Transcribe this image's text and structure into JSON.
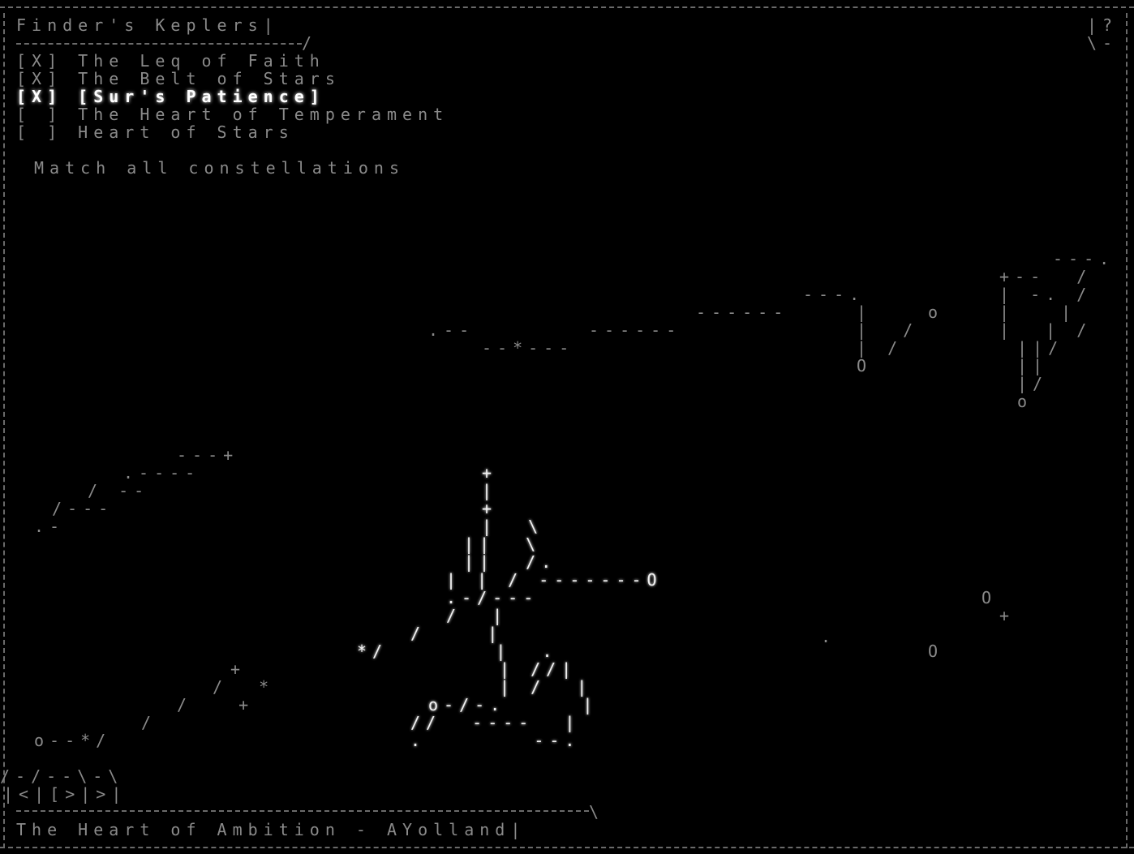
{
  "header": {
    "title": "Finder's Keplers",
    "help": "?",
    "corner": "\\-"
  },
  "checklist": [
    {
      "box": "[X]",
      "label": "The Leq of Faith"
    },
    {
      "box": "[X]",
      "label": "The Belt of Stars"
    },
    {
      "box": "[X]",
      "label": "[Sur's Patience]"
    },
    {
      "box": "[ ]",
      "label": "The Heart of Temperament"
    },
    {
      "box": "[ ]",
      "label": "Heart of Stars"
    }
  ],
  "objective": "Match all constellations",
  "nav": {
    "prev": "<",
    "pause": "[",
    "next": ">",
    "fast": ">"
  },
  "footer": {
    "status": "The Heart of Ambition - AYolland"
  }
}
